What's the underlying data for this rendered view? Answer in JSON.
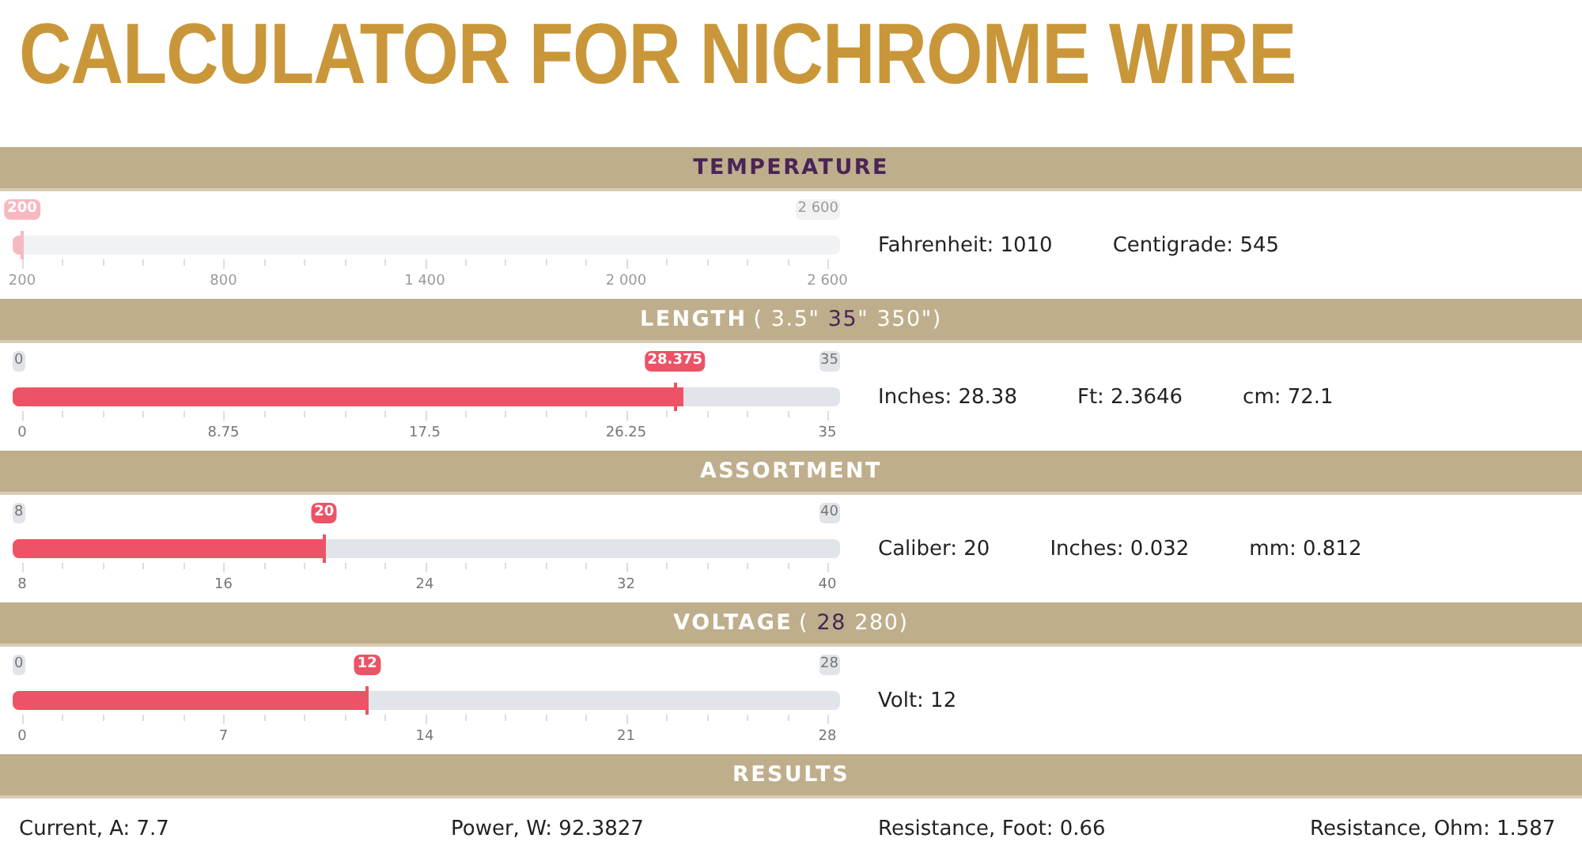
{
  "title": "CALCULATOR FOR NICHROME WIRE",
  "sections": [
    {
      "heading": {
        "title": "TEMPERATURE",
        "active": true
      },
      "slider": {
        "disabled": true,
        "level": 0,
        "max_label": "2 600",
        "value_label": "200",
        "ticks": [
          "200",
          "800",
          "1 400",
          "2 000",
          "2 600"
        ]
      },
      "readouts": [
        "Fahrenheit: 1010",
        "Centigrade: 545"
      ]
    },
    {
      "heading": {
        "title": "LENGTH",
        "active": false,
        "range": [
          {
            "text": "( 3.5\" ",
            "highlight": false
          },
          {
            "text": "35",
            "highlight": true
          },
          {
            "text": "\" 350\")",
            "highlight": false
          }
        ]
      },
      "slider": {
        "disabled": false,
        "level": 0.8107,
        "min_label": "0",
        "max_label": "35",
        "value_label": "28.375",
        "ticks": [
          "0",
          "8.75",
          "17.5",
          "26.25",
          "35"
        ]
      },
      "readouts": [
        "Inches: 28.38",
        "Ft: 2.3646",
        "cm: 72.1"
      ]
    },
    {
      "heading": {
        "title": "ASSORTMENT",
        "active": false
      },
      "slider": {
        "disabled": false,
        "level": 0.375,
        "min_label": "8",
        "max_label": "40",
        "value_label": "20",
        "ticks": [
          "8",
          "16",
          "24",
          "32",
          "40"
        ]
      },
      "readouts": [
        "Caliber: 20",
        "Inches: 0.032",
        "mm: 0.812"
      ]
    },
    {
      "heading": {
        "title": "VOLTAGE",
        "active": false,
        "range": [
          {
            "text": "( ",
            "highlight": false
          },
          {
            "text": "28",
            "highlight": true
          },
          {
            "text": " 280)",
            "highlight": false
          }
        ]
      },
      "slider": {
        "disabled": false,
        "level": 0.4286,
        "min_label": "0",
        "max_label": "28",
        "value_label": "12",
        "ticks": [
          "0",
          "7",
          "14",
          "21",
          "28"
        ]
      },
      "readouts": [
        "Volt: 12"
      ]
    }
  ],
  "results": {
    "heading": {
      "title": "RESULTS",
      "active": false
    },
    "items": [
      "Current, A: 7.7",
      "Power, W: 92.3827",
      "Resistance, Foot: 0.66",
      "Resistance, Ohm: 1.587"
    ]
  }
}
